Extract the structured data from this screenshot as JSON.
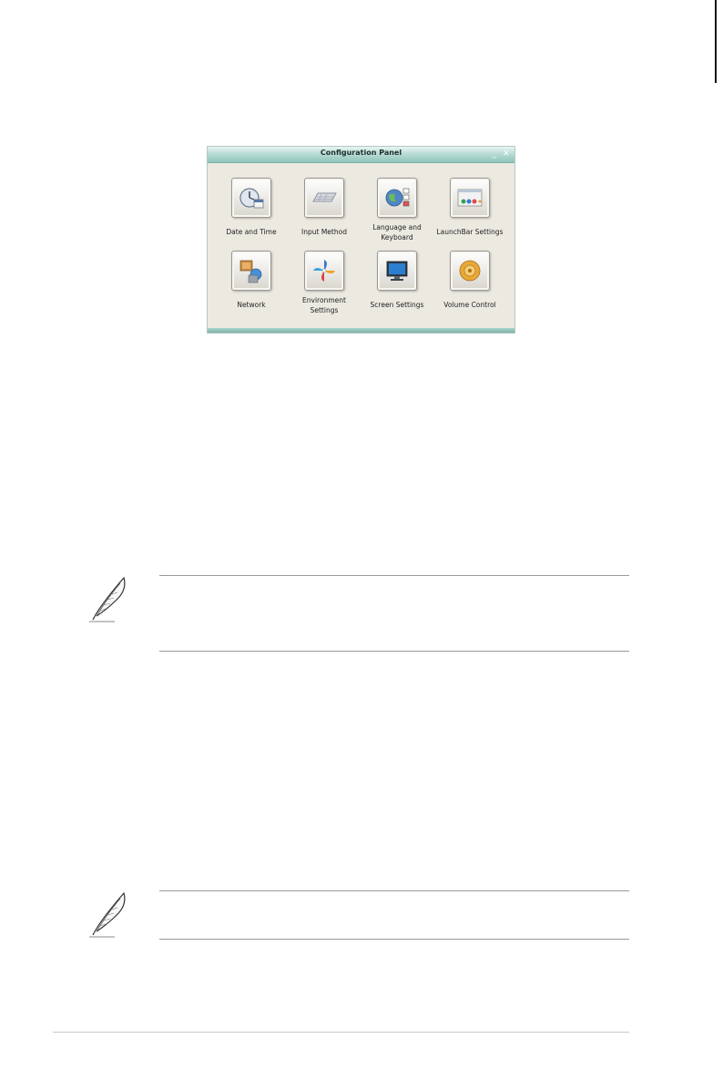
{
  "window": {
    "title": "Configuration Panel",
    "minimize_glyph": "_",
    "close_glyph": "✕"
  },
  "items": [
    {
      "label": "Date and Time",
      "icon": "clock-icon"
    },
    {
      "label": "Input Method",
      "icon": "keyboard-icon"
    },
    {
      "label": "Language and Keyboard",
      "label_line1": "Language and",
      "label_line2": "Keyboard",
      "icon": "globe-icon"
    },
    {
      "label": "LaunchBar Settings",
      "icon": "launchbar-icon"
    },
    {
      "label": "Network",
      "icon": "network-icon"
    },
    {
      "label": "Environment Settings",
      "label_line1": "Environment",
      "label_line2": "Settings",
      "icon": "pinwheel-icon"
    },
    {
      "label": "Screen Settings",
      "icon": "monitor-icon"
    },
    {
      "label": "Volume Control",
      "icon": "speaker-icon"
    }
  ],
  "notes": [
    {
      "icon": "feather-icon"
    },
    {
      "icon": "feather-icon"
    }
  ]
}
